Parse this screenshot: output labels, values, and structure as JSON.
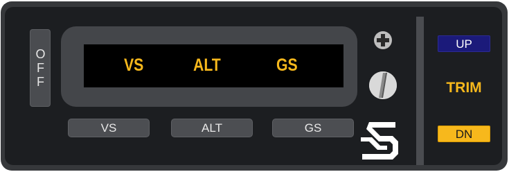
{
  "off_button": {
    "label": "OFF"
  },
  "annunciators": {
    "vs": "VS",
    "alt": "ALT",
    "gs": "GS"
  },
  "mode_buttons": {
    "vs": "VS",
    "alt": "ALT",
    "gs": "GS"
  },
  "trim": {
    "up_label": "UP",
    "title": "TRIM",
    "dn_label": "DN"
  },
  "icons": {
    "adjust_knob": "plus-icon",
    "dimmer_knob": "screw-knob-icon",
    "brand": "logo-icon"
  },
  "colors": {
    "annunciator": "#f7b81c",
    "up_button": "#1b1a7a",
    "dn_button": "#f7b81c",
    "panel": "#1c1e21",
    "bezel": "#36383b"
  }
}
